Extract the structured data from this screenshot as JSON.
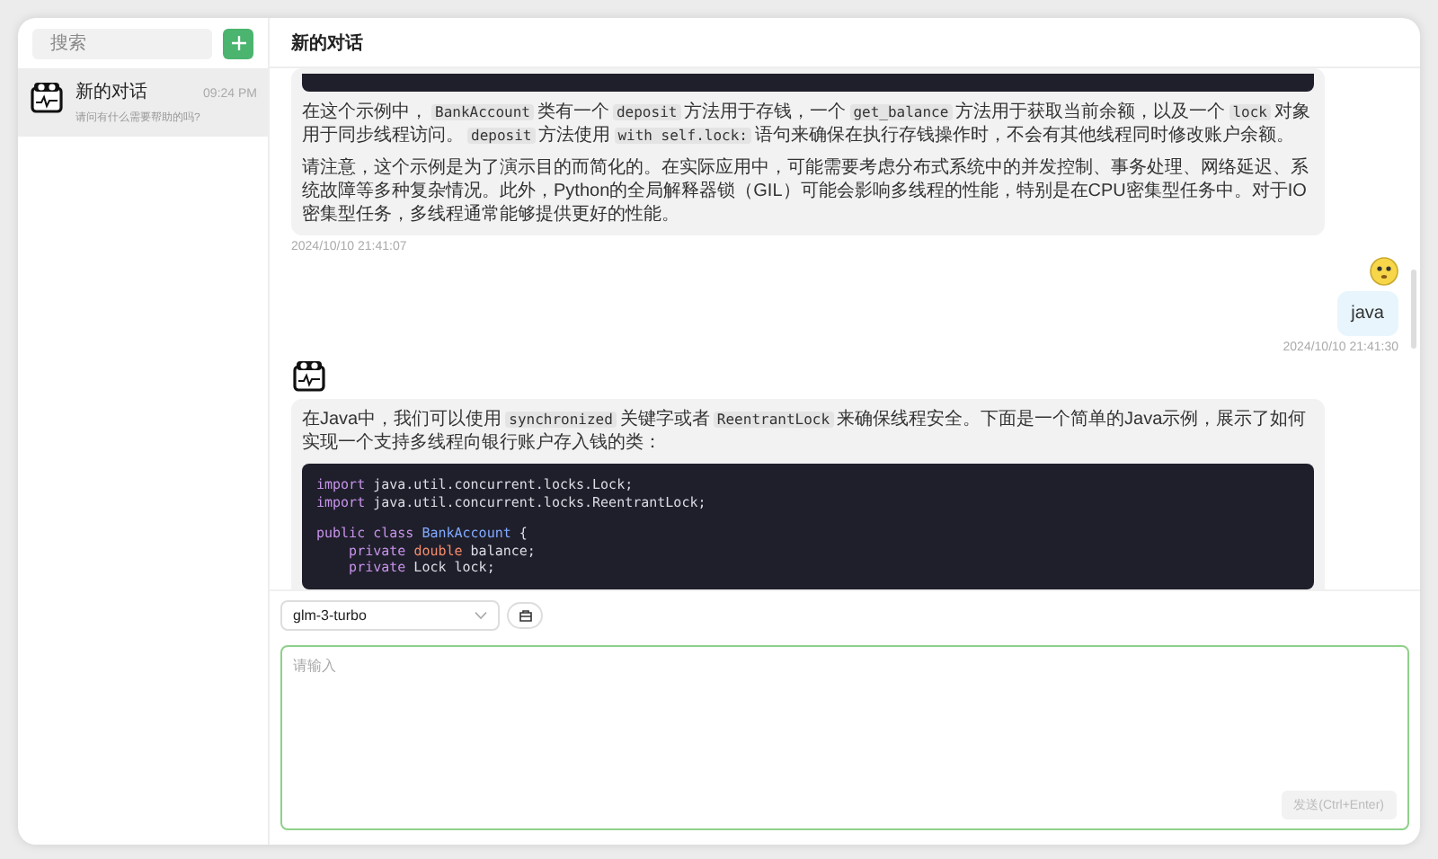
{
  "sidebar": {
    "search": {
      "placeholder": "搜索"
    },
    "conversations": [
      {
        "title": "新的对话",
        "time": "09:24 PM",
        "subtitle": "请问有什么需要帮助的吗?",
        "selected": true
      }
    ]
  },
  "header": {
    "title": "新的对话"
  },
  "messages": [
    {
      "kind": "assistant",
      "time": "2024/10/10 21:41:07",
      "parts": [
        {
          "kind": "code_cut"
        },
        {
          "kind": "paragraph",
          "segments": [
            {
              "text": "在这个示例中，",
              "kind": "text"
            },
            {
              "text": "BankAccount",
              "kind": "code"
            },
            {
              "text": "类有一个",
              "kind": "text"
            },
            {
              "text": "deposit",
              "kind": "code"
            },
            {
              "text": "方法用于存钱，一个",
              "kind": "text"
            },
            {
              "text": "get_balance",
              "kind": "code"
            },
            {
              "text": "方法用于获取当前余额，以及一个",
              "kind": "text"
            },
            {
              "text": "lock",
              "kind": "code"
            },
            {
              "text": "对象用于同步线程访问。",
              "kind": "text"
            },
            {
              "text": "deposit",
              "kind": "code"
            },
            {
              "text": "方法使用",
              "kind": "text"
            },
            {
              "text": "with self.lock:",
              "kind": "code"
            },
            {
              "text": "语句来确保在执行存钱操作时，不会有其他线程同时修改账户余额。",
              "kind": "text"
            }
          ]
        },
        {
          "kind": "paragraph",
          "segments": [
            {
              "text": "请注意，这个示例是为了演示目的而简化的。在实际应用中，可能需要考虑分布式系统中的并发控制、事务处理、网络延迟、系统故障等多种复杂情况。此外，Python的全局解释器锁（GIL）可能会影响多线程的性能，特别是在CPU密集型任务中。对于IO密集型任务，多线程通常能够提供更好的性能。",
              "kind": "text"
            }
          ]
        }
      ]
    },
    {
      "kind": "user",
      "time": "2024/10/10 21:41:30",
      "parts": [
        {
          "kind": "paragraph",
          "segments": [
            {
              "text": "java",
              "kind": "text"
            }
          ]
        }
      ]
    },
    {
      "kind": "assistant",
      "parts": [
        {
          "kind": "paragraph",
          "segments": [
            {
              "text": "在Java中，我们可以使用",
              "kind": "text"
            },
            {
              "text": "synchronized",
              "kind": "code"
            },
            {
              "text": "关键字或者",
              "kind": "text"
            },
            {
              "text": "ReentrantLock",
              "kind": "code"
            },
            {
              "text": "来确保线程安全。下面是一个简单的Java示例，展示了如何实现一个支持多线程向银行账户存入钱的类：",
              "kind": "text"
            }
          ]
        },
        {
          "kind": "code",
          "blocks": [
            [
              [
                {
                  "text": "import",
                  "kind": "keyword"
                },
                {
                  "text": " java.util.concurrent.locks.Lock;",
                  "kind": "plain"
                }
              ],
              [
                {
                  "text": "import",
                  "kind": "keyword"
                },
                {
                  "text": " java.util.concurrent.locks.ReentrantLock;",
                  "kind": "plain"
                }
              ]
            ],
            [
              [
                {
                  "text": "public class ",
                  "kind": "keyword"
                },
                {
                  "text": "BankAccount",
                  "kind": "class"
                },
                {
                  "text": " {",
                  "kind": "plain"
                }
              ],
              [
                {
                  "text": "    private ",
                  "kind": "keyword"
                },
                {
                  "text": "double",
                  "kind": "type"
                },
                {
                  "text": " balance;",
                  "kind": "plain"
                }
              ],
              [
                {
                  "text": "    private",
                  "kind": "keyword"
                },
                {
                  "text": " Lock lock;",
                  "kind": "plain"
                }
              ]
            ]
          ]
        }
      ]
    }
  ],
  "composer": {
    "model": "glm-3-turbo",
    "placeholder": "请输入",
    "send": {
      "label": "发送(Ctrl+Enter)",
      "disabled": true
    }
  }
}
